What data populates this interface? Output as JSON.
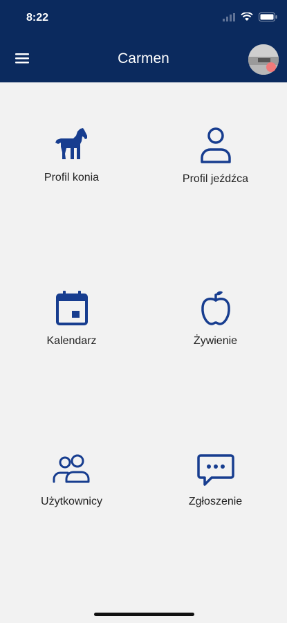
{
  "status_bar": {
    "time": "8:22"
  },
  "header": {
    "title": "Carmen"
  },
  "tiles": [
    {
      "label": "Profil konia"
    },
    {
      "label": "Profil jeźdźca"
    },
    {
      "label": "Kalendarz"
    },
    {
      "label": "Żywienie"
    },
    {
      "label": "Użytkownicy"
    },
    {
      "label": "Zgłoszenie"
    }
  ],
  "colors": {
    "header": "#0b2a5e",
    "icon": "#173d8f",
    "background": "#f2f2f2"
  },
  "icons": [
    "menu-icon",
    "horse-icon",
    "person-icon",
    "calendar-icon",
    "apple-icon",
    "users-icon",
    "chat-icon"
  ]
}
